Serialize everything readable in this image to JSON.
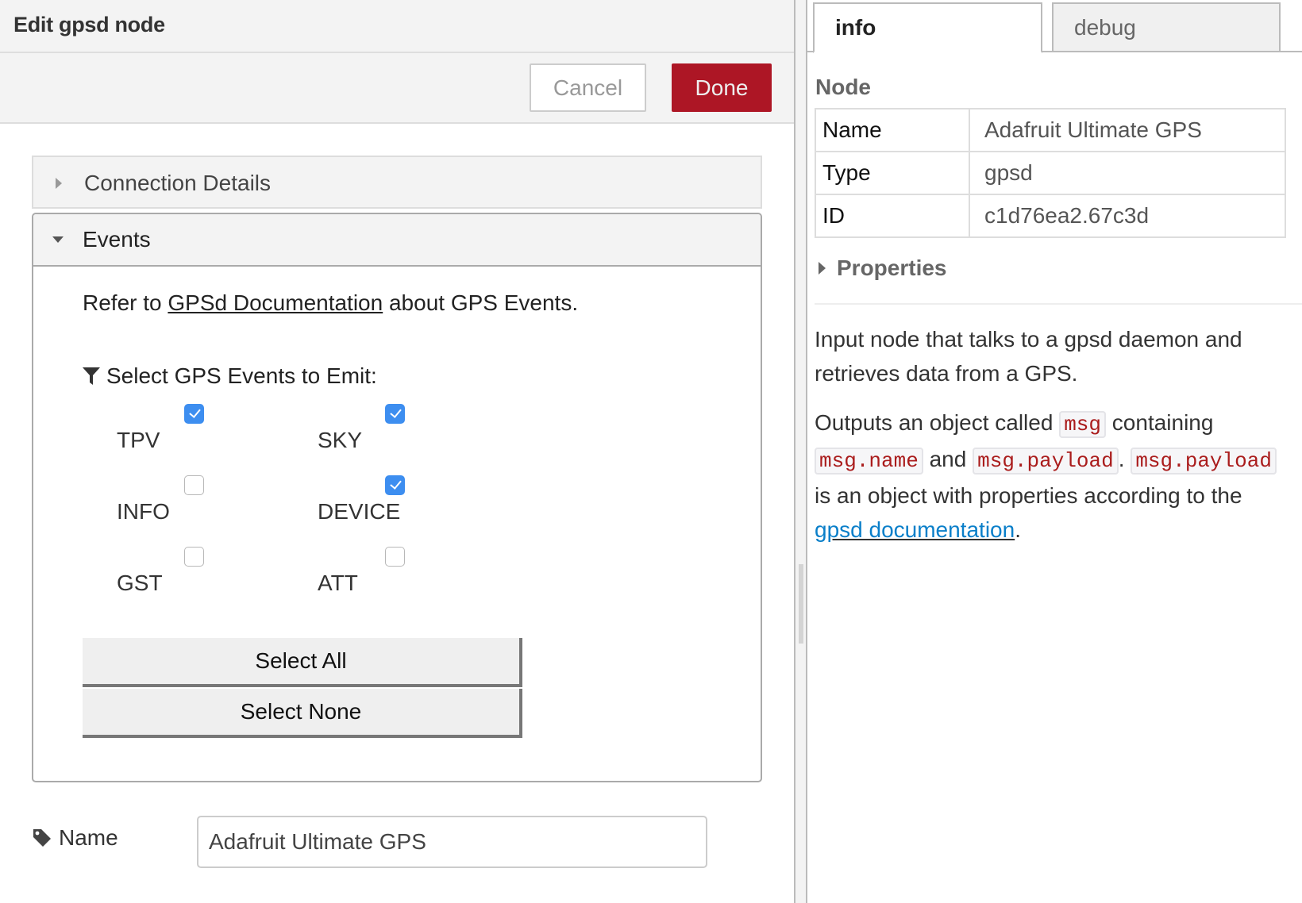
{
  "tray": {
    "title": "Edit gpsd node",
    "cancel_label": "Cancel",
    "done_label": "Done",
    "done_color": "#ad1625",
    "sections": {
      "connection": {
        "label": "Connection Details",
        "expanded": false
      },
      "events": {
        "label": "Events",
        "expanded": true
      }
    },
    "refer_prefix": "Refer to ",
    "refer_link": "GPSd Documentation",
    "refer_suffix": " about GPS Events.",
    "select_label": "Select GPS Events to Emit:",
    "events": [
      {
        "label": "TPV",
        "checked": true
      },
      {
        "label": "SKY",
        "checked": true
      },
      {
        "label": "INFO",
        "checked": false
      },
      {
        "label": "DEVICE",
        "checked": true
      },
      {
        "label": "GST",
        "checked": false
      },
      {
        "label": "ATT",
        "checked": false
      }
    ],
    "select_all_label": "Select All",
    "select_none_label": "Select None",
    "name_label": "Name",
    "name_value": "Adafruit Ultimate GPS"
  },
  "sidebar": {
    "tabs": [
      {
        "label": "info",
        "active": true
      },
      {
        "label": "debug",
        "active": false
      }
    ],
    "node_heading": "Node",
    "node_rows": [
      {
        "key": "Name",
        "value": "Adafruit Ultimate GPS"
      },
      {
        "key": "Type",
        "value": "gpsd"
      },
      {
        "key": "ID",
        "value": "c1d76ea2.67c3d"
      }
    ],
    "properties_label": "Properties",
    "help": {
      "p1": "Input node that talks to a gpsd daemon and retrieves data from a GPS.",
      "p2_a": "Outputs an object called ",
      "code_msg": "msg",
      "p2_b": " containing ",
      "code_msg_name": "msg.name",
      "p2_c": " and ",
      "code_msg_payload": "msg.payload",
      "p2_d": ". ",
      "code_msg_payload2": "msg.payload",
      "p2_e": " is an object with properties according to the ",
      "link": "gpsd documentation",
      "p2_f": "."
    },
    "link_color": "#0a7fc9",
    "code_color": "#aa1c1c"
  }
}
